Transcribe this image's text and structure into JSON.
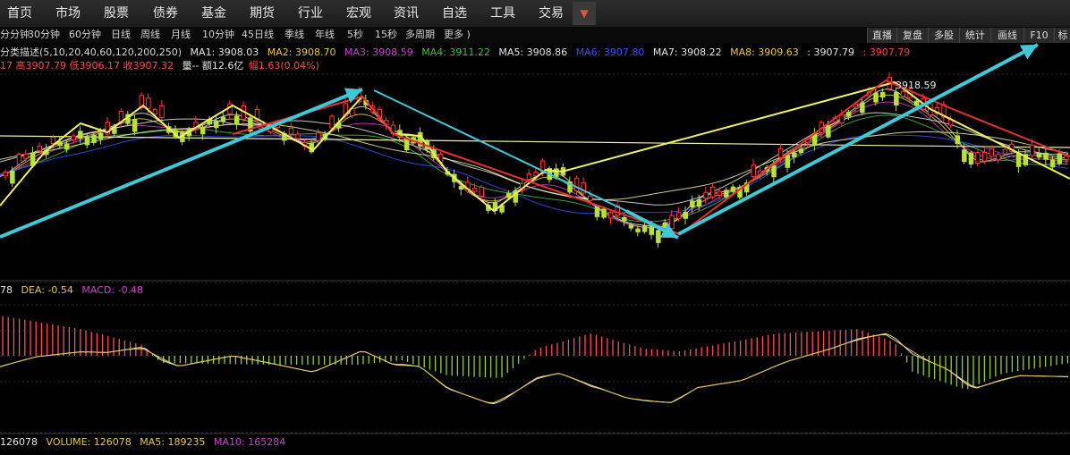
{
  "menu": [
    "首页",
    "市场",
    "股票",
    "债券",
    "基金",
    "期货",
    "行业",
    "宏观",
    "资讯",
    "自选",
    "工具",
    "交易"
  ],
  "menu_arrow": "▼",
  "timeframes": [
    "分分钟",
    "30分钟",
    "60分钟",
    "日线",
    "周线",
    "月线",
    "10分钟",
    "45日线",
    "季线",
    "年线",
    "5秒",
    "15秒",
    "多周期",
    "更多 )"
  ],
  "right_buttons": [
    "直播",
    "复盘",
    "多股",
    "统计",
    "画线",
    "F10",
    "标"
  ],
  "ma_line": {
    "prefix": "分类描述(5,10,20,40,60,120,200,250)",
    "items": [
      {
        "label": "MA1: 3908.03",
        "color": "#e6e6e6"
      },
      {
        "label": "MA2: 3908.70",
        "color": "#e8c84a"
      },
      {
        "label": "MA3: 3908.59",
        "color": "#d040d0"
      },
      {
        "label": "MA4: 3911.22",
        "color": "#40c040"
      },
      {
        "label": "MA5: 3908.86",
        "color": "#e6e6e6"
      },
      {
        "label": "MA6: 3907.80",
        "color": "#3050ff"
      },
      {
        "label": "MA7: 3908.22",
        "color": "#e6e6e6"
      },
      {
        "label": "MA8: 3909.63",
        "color": "#e8c84a"
      },
      {
        "label": ": 3907.79",
        "color": "#e6e6e6"
      },
      {
        "label": ": 3907.79",
        "color": "#ff4040"
      }
    ]
  },
  "quote_line": {
    "a": "17 高3907.79 低3906.17 收3907.32",
    "b": "量-- 额12.6亿",
    "c": "幅1.63(0.04%)"
  },
  "peak_label": "3918.59",
  "macd_line": {
    "a": "78",
    "b": "DEA: -0.54",
    "c": "MACD: -0.48"
  },
  "volume_line": {
    "a": "126078",
    "b": "VOLUME: 126078",
    "c": "MA5: 189235",
    "d": "MA10: 165284"
  },
  "colors": {
    "up": "#ff3838",
    "down": "#b8e03c",
    "cyan": "#3ec8d8",
    "yellow": "#f0f060",
    "red": "#e83030"
  }
}
